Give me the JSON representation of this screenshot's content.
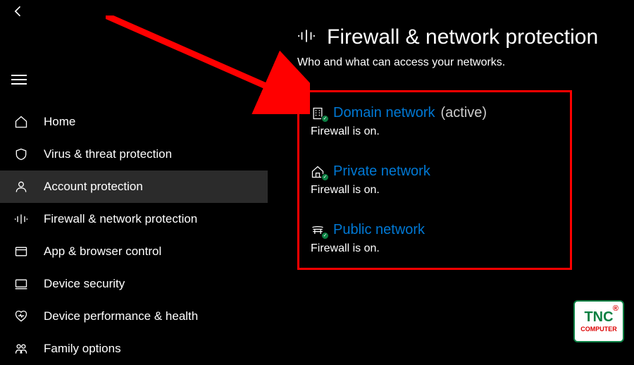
{
  "header": {
    "title": "Firewall & network protection",
    "subtitle": "Who and what can access your networks."
  },
  "sidebar": {
    "items": [
      {
        "label": "Home",
        "icon": "home-icon"
      },
      {
        "label": "Virus & threat protection",
        "icon": "shield-icon"
      },
      {
        "label": "Account protection",
        "icon": "person-icon"
      },
      {
        "label": "Firewall & network protection",
        "icon": "network-icon"
      },
      {
        "label": "App & browser control",
        "icon": "app-icon"
      },
      {
        "label": "Device security",
        "icon": "device-icon"
      },
      {
        "label": "Device performance & health",
        "icon": "heart-icon"
      },
      {
        "label": "Family options",
        "icon": "family-icon"
      }
    ]
  },
  "networks": [
    {
      "name": "Domain network",
      "status_label": "(active)",
      "status": "Firewall is on.",
      "icon": "building-icon"
    },
    {
      "name": "Private network",
      "status_label": "",
      "status": "Firewall is on.",
      "icon": "house-icon"
    },
    {
      "name": "Public network",
      "status_label": "",
      "status": "Firewall is on.",
      "icon": "bench-icon"
    }
  ],
  "watermark": {
    "brand": "TNC",
    "sub": "COMPUTER",
    "reg": "®"
  }
}
